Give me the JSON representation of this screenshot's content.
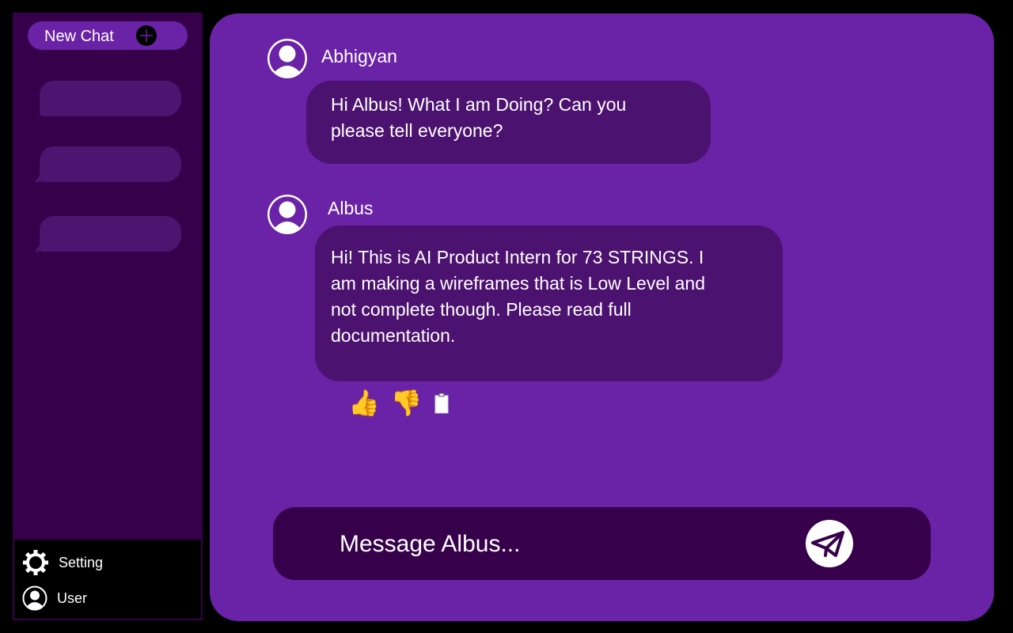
{
  "sidebar": {
    "new_chat_label": "New Chat",
    "history_items": [
      "",
      "",
      ""
    ],
    "footer": {
      "setting_label": "Setting",
      "user_label": "User"
    }
  },
  "messages": [
    {
      "author": "Abhigyan",
      "lines": [
        "Hi Albus! What I am Doing? Can you",
        "please tell everyone?"
      ]
    },
    {
      "author": "Albus",
      "lines": [
        "Hi! This is AI Product Intern for 73 STRINGS. I",
        "am making a wireframes that is Low Level and",
        "not complete though. Please read full",
        "documentation."
      ]
    }
  ],
  "message_actions": {
    "like_icon": "👍",
    "dislike_icon": "👎",
    "copy_icon_name": "clipboard-icon"
  },
  "composer": {
    "placeholder": "Message Albus..."
  },
  "colors": {
    "background": "#000000",
    "sidebar": "#36004b",
    "main": "#6a22a6",
    "bubble": "#4c1270",
    "accent": "#6a22a6"
  }
}
